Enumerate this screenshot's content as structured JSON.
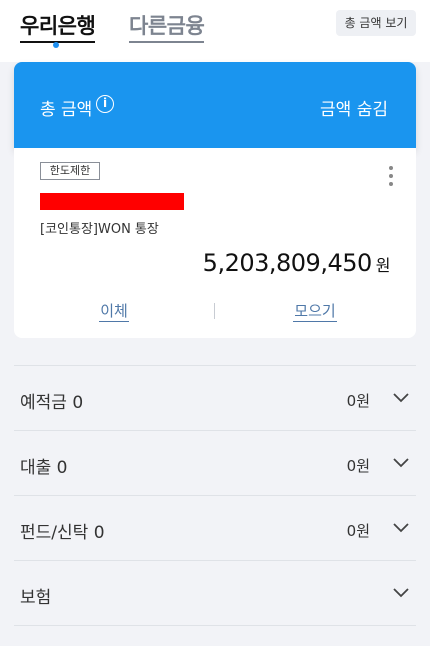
{
  "header": {
    "tab_active": "우리은행",
    "tab_inactive": "다른금융",
    "total_view_button": "총 금액 보기"
  },
  "banner": {
    "label": "총 금액",
    "info_icon": "i",
    "hide_button": "금액 숨김"
  },
  "card": {
    "limit_badge": "한도제한",
    "account_name": "[코인통장]WON 통장",
    "balance": "5,203,809,450",
    "balance_unit": "원",
    "transfer_button": "이체",
    "collect_button": "모으기",
    "icons": [
      "more-vertical-icon"
    ]
  },
  "categories": [
    {
      "label": "예적금 0",
      "amount": "0원"
    },
    {
      "label": "대출 0",
      "amount": "0원"
    },
    {
      "label": "펀드/신탁 0",
      "amount": "0원"
    },
    {
      "label": "보험",
      "amount": ""
    }
  ],
  "colors": {
    "accent_blue": "#1a95ef",
    "link_blue": "#4f78a8",
    "background": "#f2f3f7"
  }
}
